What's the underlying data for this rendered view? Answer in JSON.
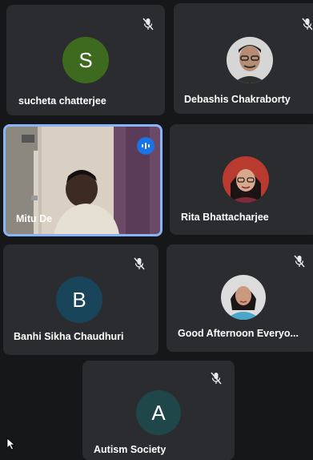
{
  "participants": [
    {
      "name": "sucheta chatterjee",
      "initial": "S",
      "avatar_color": "#3e6a1f",
      "muted": true
    },
    {
      "name": "Debashis Chakraborty",
      "muted": true
    },
    {
      "name": "Mitu De",
      "speaking": true
    },
    {
      "name": "Rita Bhattacharjee"
    },
    {
      "name": "Banhi Sikha Chaudhuri",
      "initial": "B",
      "avatar_color": "#19455a",
      "muted": true
    },
    {
      "name": "Good Afternoon Everyo...",
      "muted": true
    },
    {
      "name": "Autism Society",
      "initial": "A",
      "avatar_color": "#1f4749",
      "muted": true
    }
  ],
  "icons": {
    "muted": "mic-off-icon",
    "speaking": "audio-level-icon",
    "cursor": "mouse-pointer-icon"
  },
  "colors": {
    "background": "#161719",
    "tile": "#2b2c2f",
    "speaking_border": "#8ab4f8",
    "speaking_badge": "#1a73e8"
  }
}
